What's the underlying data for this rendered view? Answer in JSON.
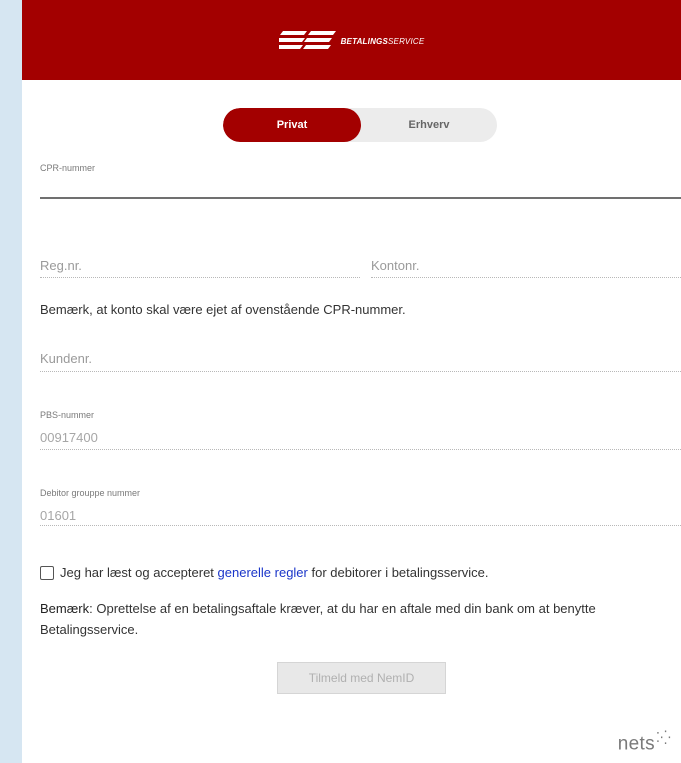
{
  "header": {
    "logo_text_bold": "BETALINGS",
    "logo_text_light": "SERVICE",
    "bg_color": "#a30000"
  },
  "toggle": {
    "options": [
      {
        "label": "Privat",
        "active": true
      },
      {
        "label": "Erhverv",
        "active": false
      }
    ]
  },
  "form": {
    "cpr_label": "CPR-nummer",
    "reg_placeholder": "Reg.nr.",
    "konto_placeholder": "Kontonr.",
    "note": "Bemærk, at konto skal være ejet af ovenstående CPR-nummer.",
    "kunde_placeholder": "Kundenr.",
    "pbs_label": "PBS-nummer",
    "pbs_value": "00917400",
    "debitor_label": "Debitor grouppe nummer",
    "debitor_value": "01601"
  },
  "consent": {
    "before": "Jeg har læst og accepteret ",
    "link": "generelle regler",
    "after": " for debitorer i betalingsservice."
  },
  "info": {
    "bold": "Bemærk",
    "text": ": Oprettelse af en betalingsaftale kræver, at du har en aftale med din bank om at benytte Betalingsservice."
  },
  "submit_label": "Tilmeld med NemID",
  "footer": {
    "brand": "nets",
    "brand_mark": "⁚⁛"
  }
}
